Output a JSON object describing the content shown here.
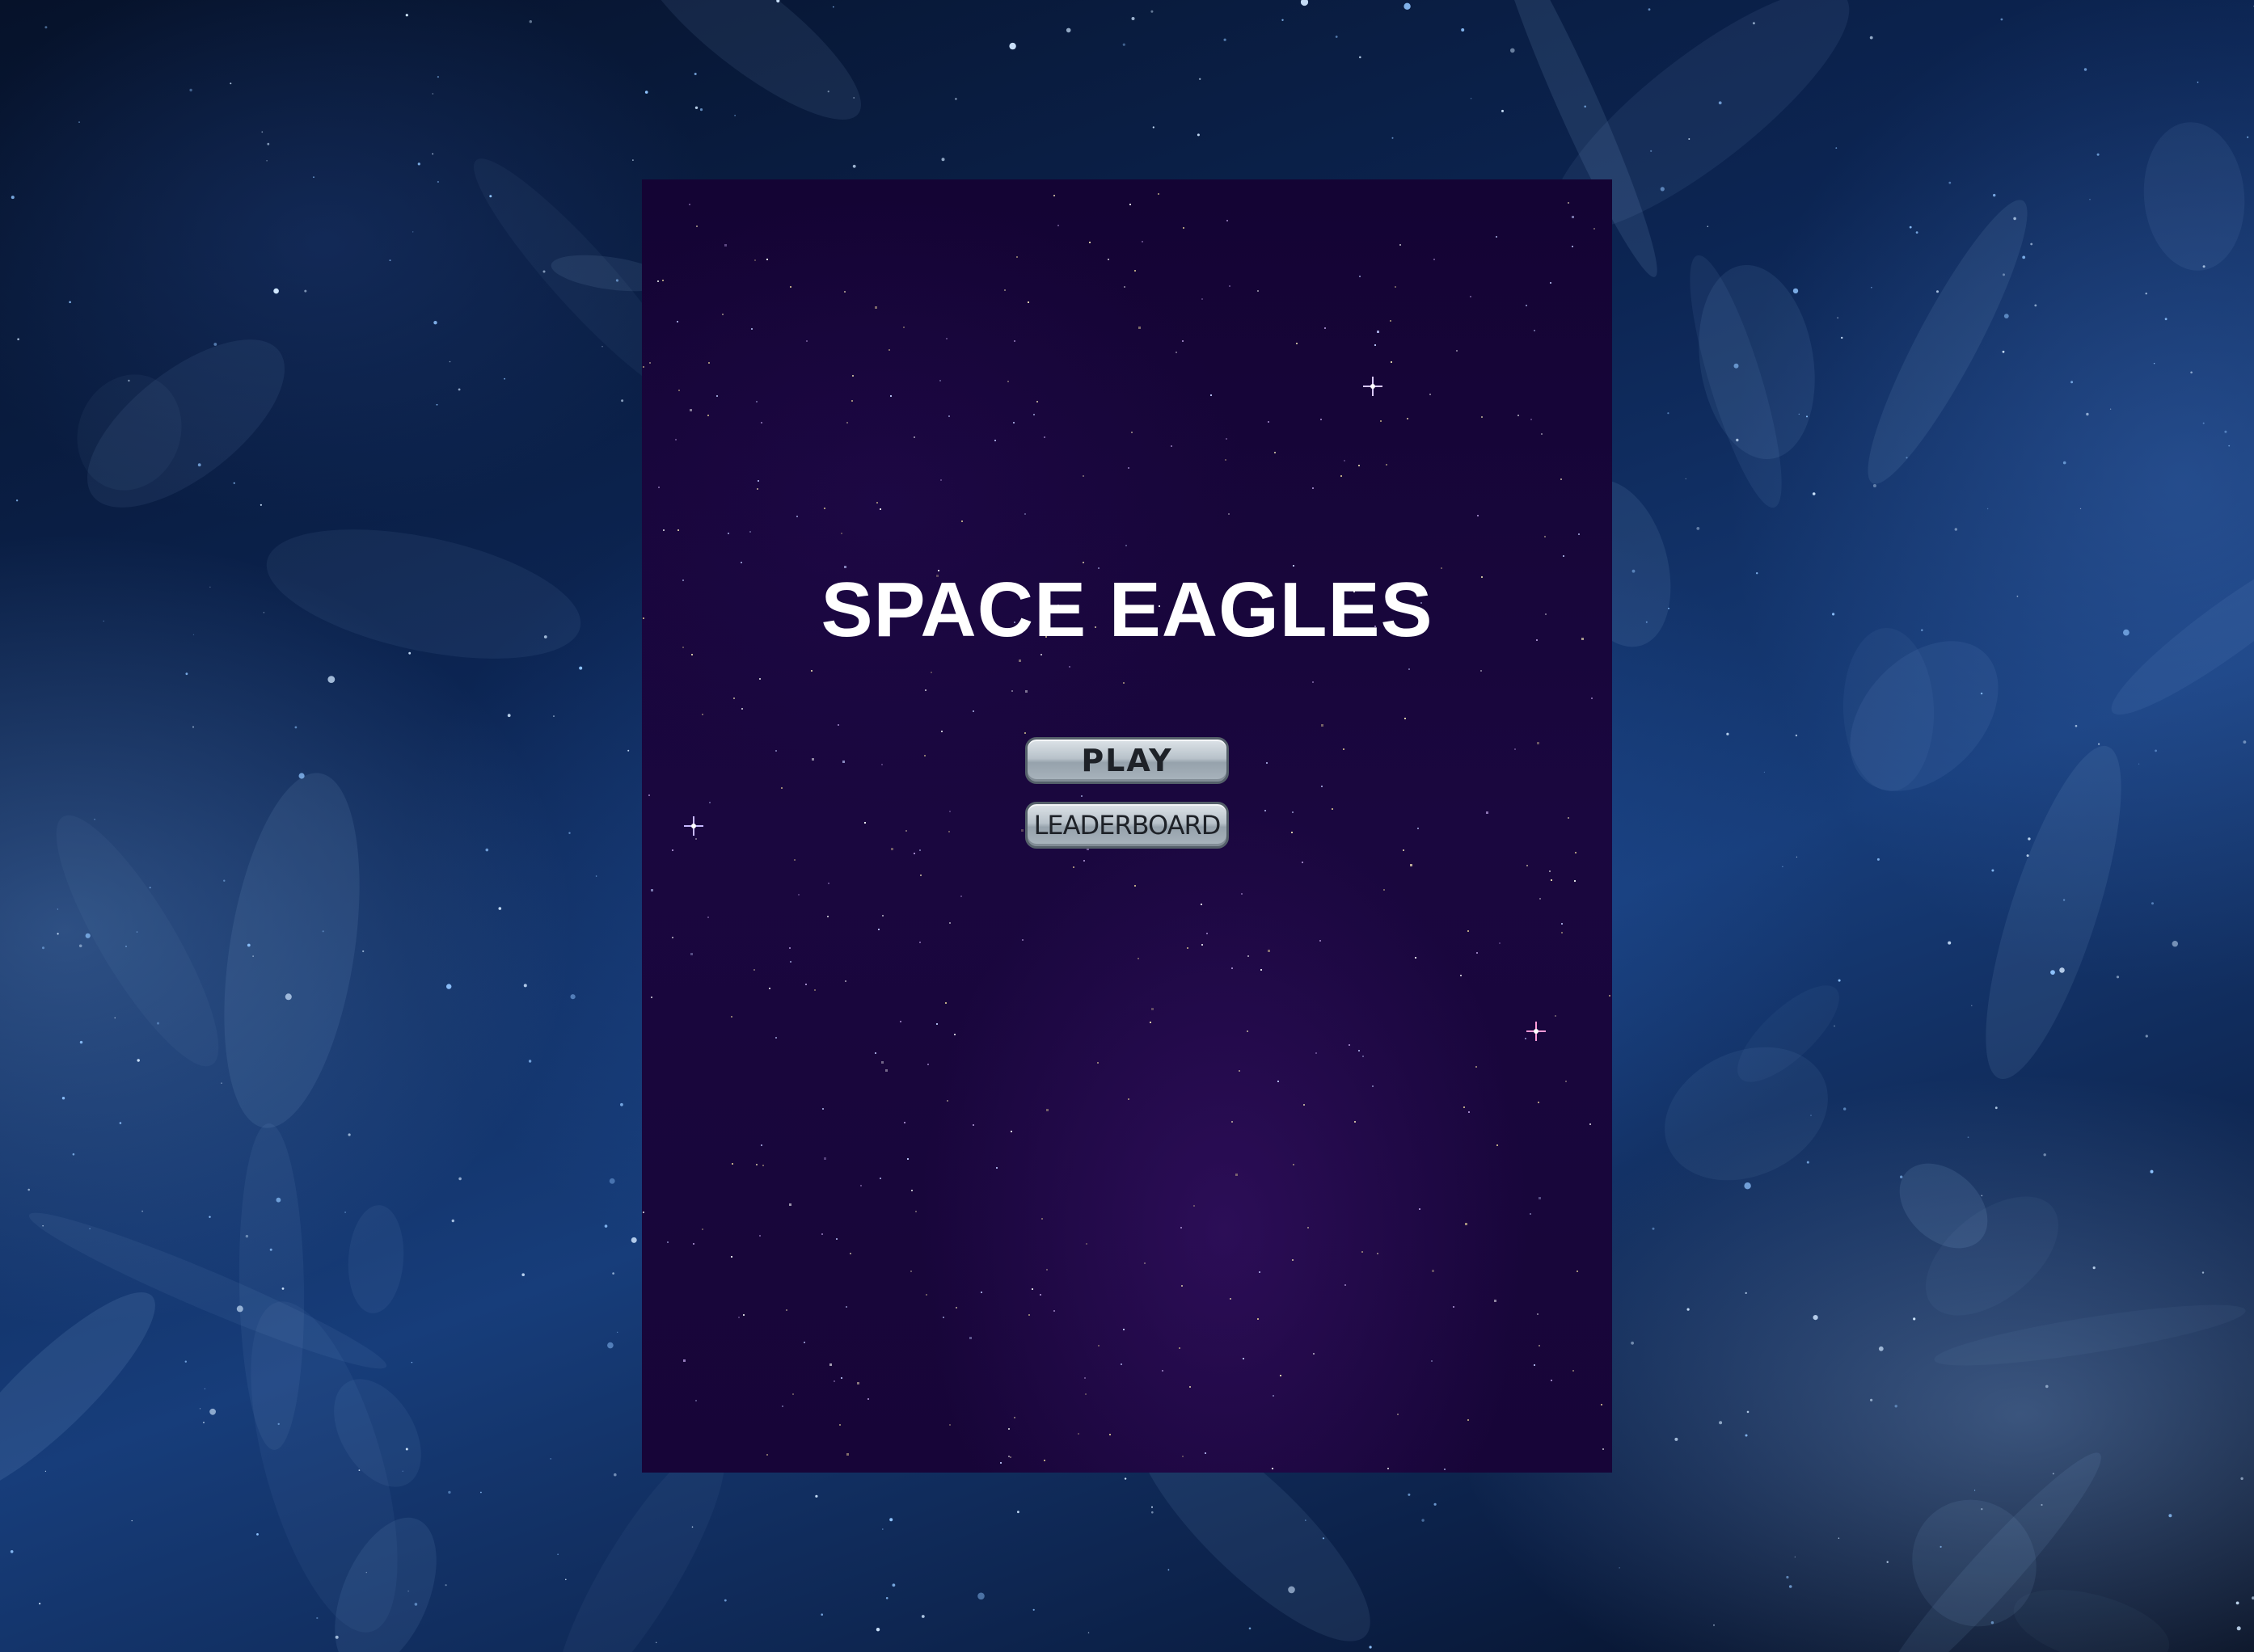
{
  "game": {
    "title": "SPACE EAGLES",
    "menu": {
      "play_label": "PLAY",
      "leaderboard_label": "LEADERBOARD"
    }
  },
  "colors": {
    "background_space": "#0c2553",
    "canvas_background": "#170538",
    "title_text": "#ffffff",
    "button_face": "#b8c2ca",
    "button_text": "#1e2228"
  }
}
